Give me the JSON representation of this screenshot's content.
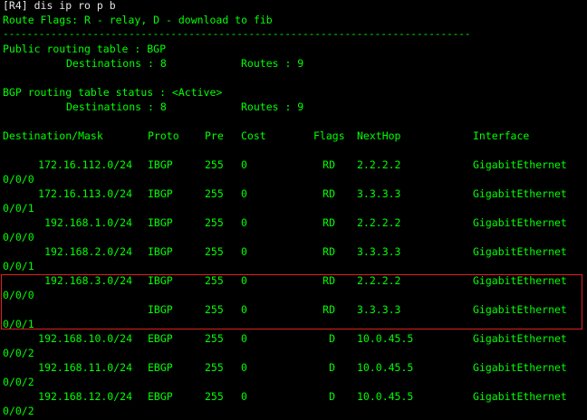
{
  "terminal": {
    "command": "[R4] dis ip ro p b",
    "flags_legend": "Route Flags: R - relay, D - download to fib",
    "separator": "------------------------------------------------------------------------------",
    "public_title": "Public routing table : BGP",
    "public_dest": "Destinations : 8",
    "public_routes": "Routes : 9",
    "status_title": "BGP routing table status : <Active>",
    "status_dest": "Destinations : 8",
    "status_routes": "Routes : 9",
    "headers": {
      "dest": "Destination/Mask",
      "proto": "Proto",
      "pre": "Pre",
      "cost": "Cost",
      "flags": "Flags",
      "nexthop": "NextHop",
      "iface": "Interface"
    },
    "routes": [
      {
        "dest": "172.16.112.0/24",
        "proto": "IBGP",
        "pre": "255",
        "cost": "0",
        "flags": "RD",
        "nexthop": "2.2.2.2",
        "iface": "GigabitEthernet",
        "iface2": "0/0/0"
      },
      {
        "dest": "172.16.113.0/24",
        "proto": "IBGP",
        "pre": "255",
        "cost": "0",
        "flags": "RD",
        "nexthop": "3.3.3.3",
        "iface": "GigabitEthernet",
        "iface2": "0/0/1"
      },
      {
        "dest": "192.168.1.0/24",
        "proto": "IBGP",
        "pre": "255",
        "cost": "0",
        "flags": "RD",
        "nexthop": "2.2.2.2",
        "iface": "GigabitEthernet",
        "iface2": "0/0/0"
      },
      {
        "dest": "192.168.2.0/24",
        "proto": "IBGP",
        "pre": "255",
        "cost": "0",
        "flags": "RD",
        "nexthop": "3.3.3.3",
        "iface": "GigabitEthernet",
        "iface2": "0/0/1"
      },
      {
        "dest": "192.168.3.0/24",
        "proto": "IBGP",
        "pre": "255",
        "cost": "0",
        "flags": "RD",
        "nexthop": "2.2.2.2",
        "iface": "GigabitEthernet",
        "iface2": "0/0/0"
      },
      {
        "dest": "",
        "proto": "IBGP",
        "pre": "255",
        "cost": "0",
        "flags": "RD",
        "nexthop": "3.3.3.3",
        "iface": "GigabitEthernet",
        "iface2": "0/0/1"
      },
      {
        "dest": "192.168.10.0/24",
        "proto": "EBGP",
        "pre": "255",
        "cost": "0",
        "flags": "D",
        "nexthop": "10.0.45.5",
        "iface": "GigabitEthernet",
        "iface2": "0/0/2"
      },
      {
        "dest": "192.168.11.0/24",
        "proto": "EBGP",
        "pre": "255",
        "cost": "0",
        "flags": "D",
        "nexthop": "10.0.45.5",
        "iface": "GigabitEthernet",
        "iface2": "0/0/2"
      },
      {
        "dest": "192.168.12.0/24",
        "proto": "EBGP",
        "pre": "255",
        "cost": "0",
        "flags": "D",
        "nexthop": "10.0.45.5",
        "iface": "GigabitEthernet",
        "iface2": "0/0/2"
      }
    ],
    "highlight_color": "#e02020"
  }
}
